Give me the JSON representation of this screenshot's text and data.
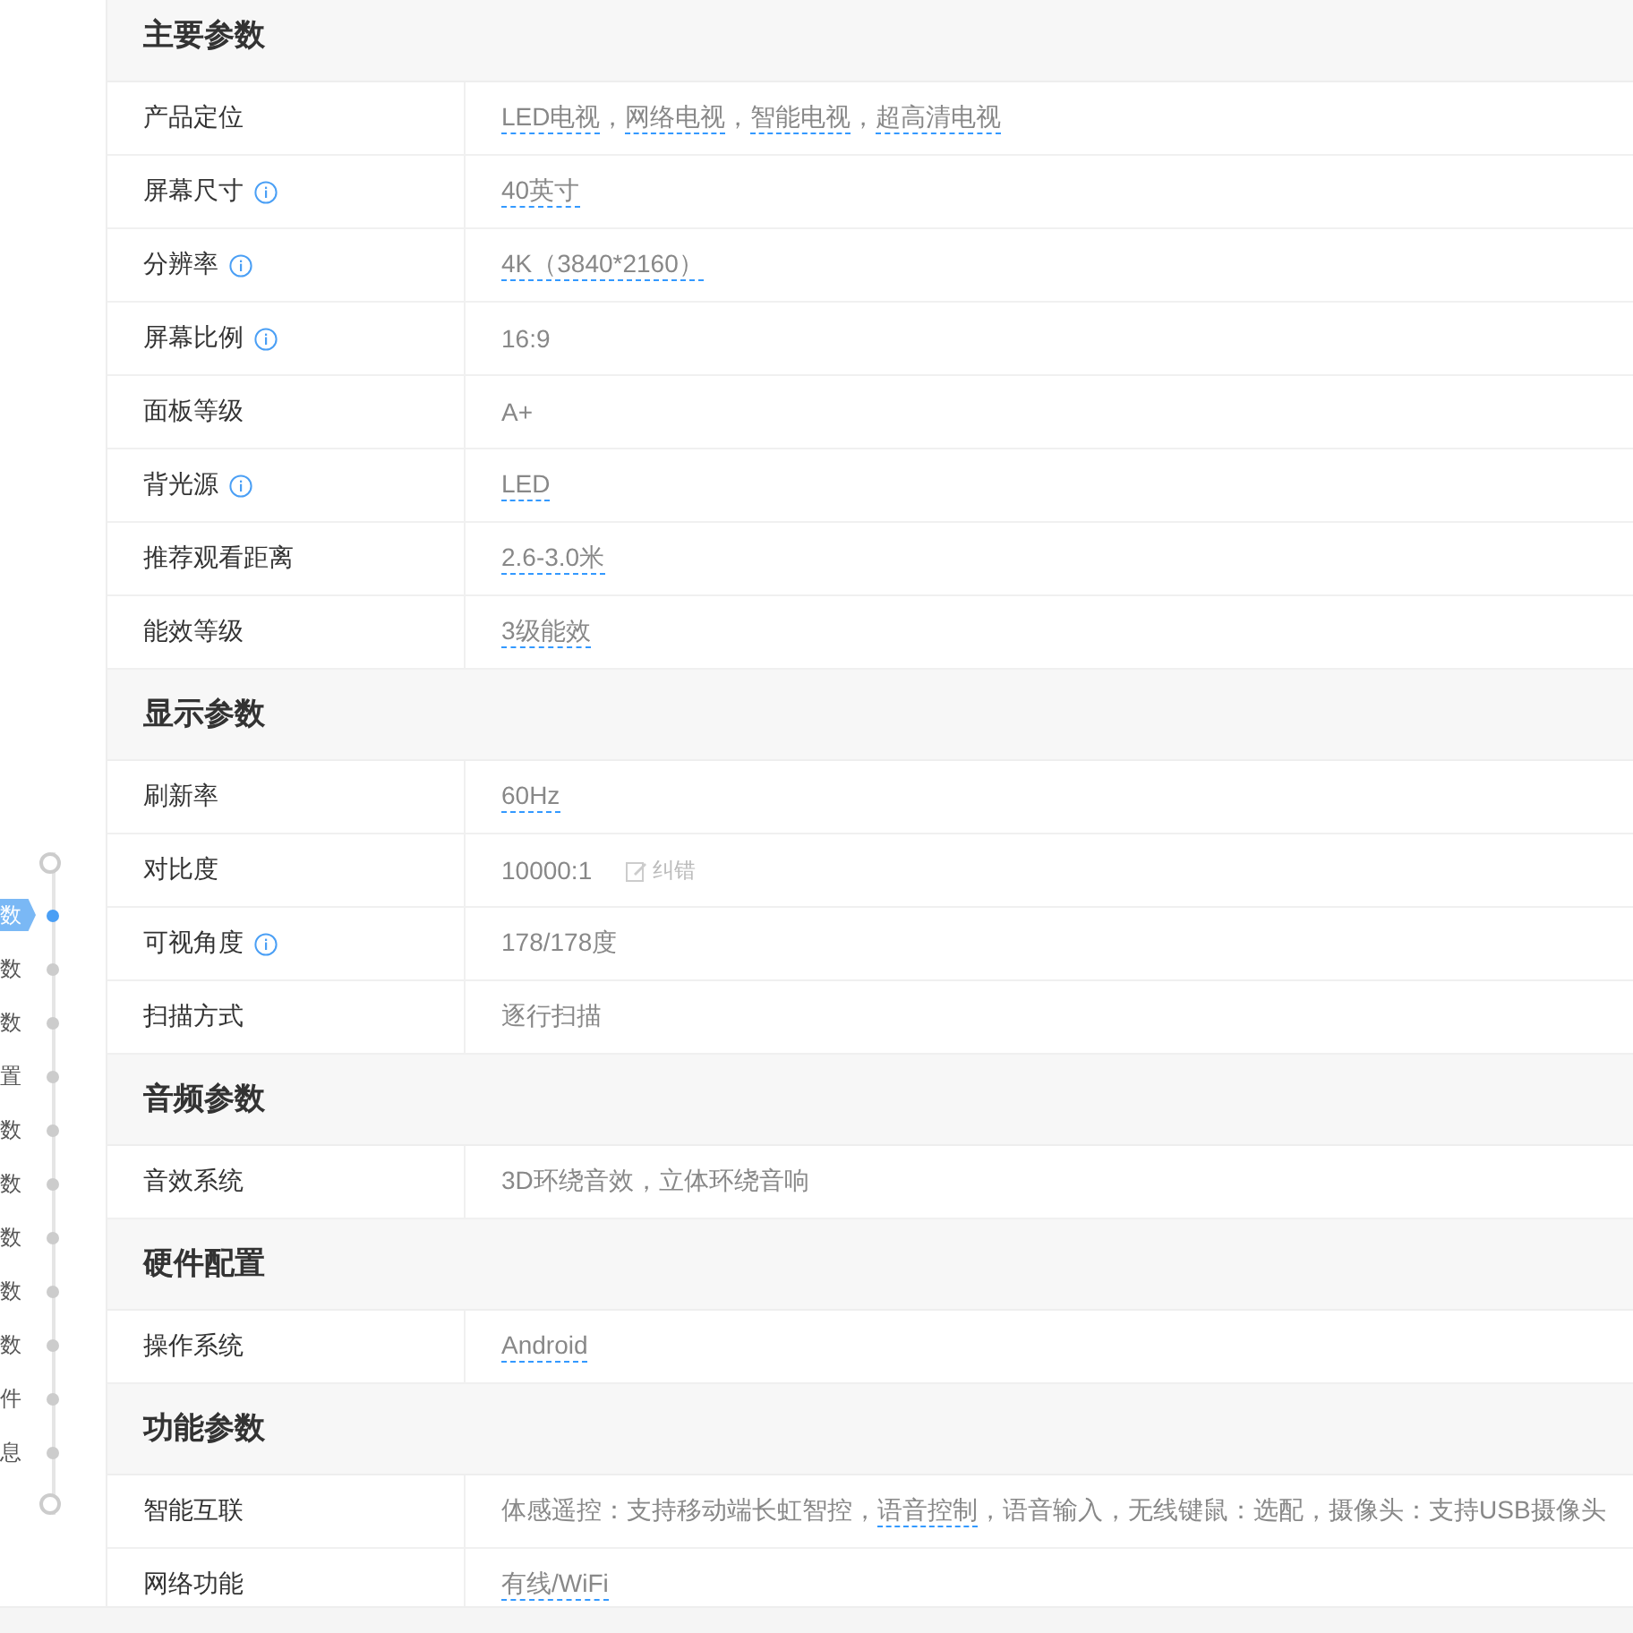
{
  "nav": {
    "items": [
      {
        "label": "数",
        "selected": true
      },
      {
        "label": "数",
        "selected": false
      },
      {
        "label": "数",
        "selected": false
      },
      {
        "label": "置",
        "selected": false
      },
      {
        "label": "数",
        "selected": false
      },
      {
        "label": "数",
        "selected": false
      },
      {
        "label": "数",
        "selected": false
      },
      {
        "label": "数",
        "selected": false
      },
      {
        "label": "数",
        "selected": false
      },
      {
        "label": "件",
        "selected": false
      },
      {
        "label": "息",
        "selected": false
      }
    ]
  },
  "sections": [
    {
      "title": "主要参数",
      "rows": [
        {
          "label": "产品定位",
          "info": false,
          "value": [
            {
              "text": "LED电视",
              "link": true
            },
            {
              "text": "，",
              "link": false
            },
            {
              "text": "网络电视",
              "link": true
            },
            {
              "text": "，",
              "link": false
            },
            {
              "text": "智能电视",
              "link": true
            },
            {
              "text": "，",
              "link": false
            },
            {
              "text": "超高清电视",
              "link": true
            }
          ]
        },
        {
          "label": "屏幕尺寸",
          "info": true,
          "value": [
            {
              "text": "40英寸",
              "link": true
            }
          ]
        },
        {
          "label": "分辨率",
          "info": true,
          "value": [
            {
              "text": "4K（3840*2160）",
              "link": true
            }
          ]
        },
        {
          "label": "屏幕比例",
          "info": true,
          "value": [
            {
              "text": "16:9",
              "link": false
            }
          ]
        },
        {
          "label": "面板等级",
          "info": false,
          "value": [
            {
              "text": "A+",
              "link": false
            }
          ]
        },
        {
          "label": "背光源",
          "info": true,
          "value": [
            {
              "text": "LED",
              "link": true
            }
          ]
        },
        {
          "label": "推荐观看距离",
          "info": false,
          "value": [
            {
              "text": "2.6-3.0米",
              "link": true
            }
          ]
        },
        {
          "label": "能效等级",
          "info": false,
          "value": [
            {
              "text": "3级能效",
              "link": true
            }
          ]
        }
      ]
    },
    {
      "title": "显示参数",
      "rows": [
        {
          "label": "刷新率",
          "info": false,
          "value": [
            {
              "text": "60Hz",
              "link": true
            }
          ]
        },
        {
          "label": "对比度",
          "info": false,
          "value": [
            {
              "text": "10000:1",
              "link": false
            }
          ],
          "correction": "纠错"
        },
        {
          "label": "可视角度",
          "info": true,
          "value": [
            {
              "text": "178/178度",
              "link": false
            }
          ]
        },
        {
          "label": "扫描方式",
          "info": false,
          "value": [
            {
              "text": "逐行扫描",
              "link": false
            }
          ]
        }
      ]
    },
    {
      "title": "音频参数",
      "rows": [
        {
          "label": "音效系统",
          "info": false,
          "value": [
            {
              "text": "3D环绕音效，立体环绕音响",
              "link": false
            }
          ]
        }
      ]
    },
    {
      "title": "硬件配置",
      "rows": [
        {
          "label": "操作系统",
          "info": false,
          "value": [
            {
              "text": "Android",
              "link": true
            }
          ]
        }
      ]
    },
    {
      "title": "功能参数",
      "rows": [
        {
          "label": "智能互联",
          "info": false,
          "value": [
            {
              "text": "体感遥控：支持移动端长虹智控，",
              "link": false
            },
            {
              "text": "语音控制",
              "link": true
            },
            {
              "text": "，语音输入，无线键鼠：选配，摄像头：支持USB摄像头",
              "link": false
            }
          ]
        },
        {
          "label": "网络功能",
          "info": false,
          "value": [
            {
              "text": "有线/WiFi",
              "link": true
            }
          ]
        }
      ]
    }
  ]
}
